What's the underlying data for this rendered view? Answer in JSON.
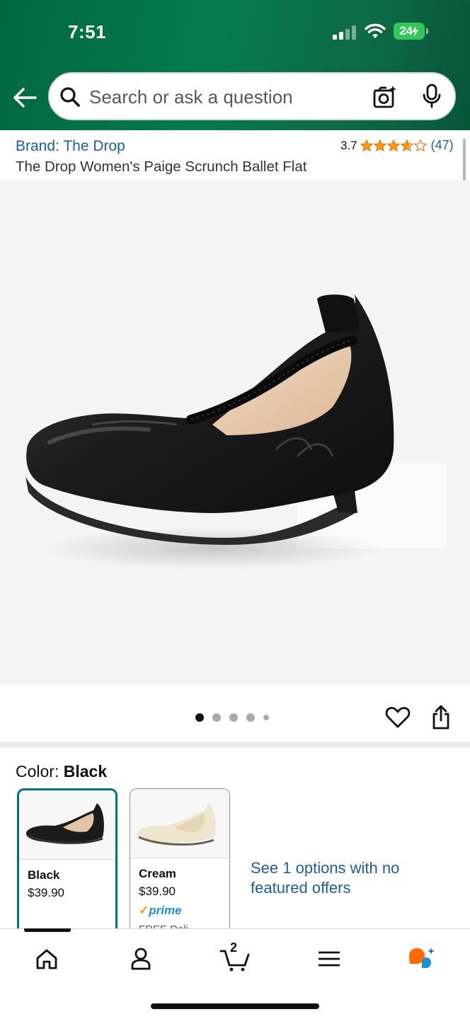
{
  "status_bar": {
    "time": "7:51",
    "battery": "24"
  },
  "search": {
    "placeholder": "Search or ask a question"
  },
  "product": {
    "brand": "Brand: The Drop",
    "rating_value": "3.7",
    "rating_stars": 3.7,
    "rating_count": "(47)",
    "title": "The Drop Women's Paige Scrunch Ballet Flat"
  },
  "gallery": {
    "image_count": 5,
    "active_index": 1
  },
  "color": {
    "label": "Color: ",
    "selected": "Black",
    "options": [
      {
        "name": "Black",
        "price": "$39.90"
      },
      {
        "name": "Cream",
        "price": "$39.90",
        "prime": "prime",
        "delivery": "FREE Deli..."
      }
    ],
    "see_more": "See 1 options with no featured offers"
  },
  "bottom_nav": {
    "items": [
      "home-icon",
      "account-icon",
      "cart-icon",
      "menu-icon",
      "rufus-icon"
    ],
    "cart_count": "2"
  },
  "colors": {
    "header_green": "#067a4e",
    "link_blue": "#1d5d99",
    "star_orange": "#ff9900",
    "selected_border": "#007185"
  }
}
